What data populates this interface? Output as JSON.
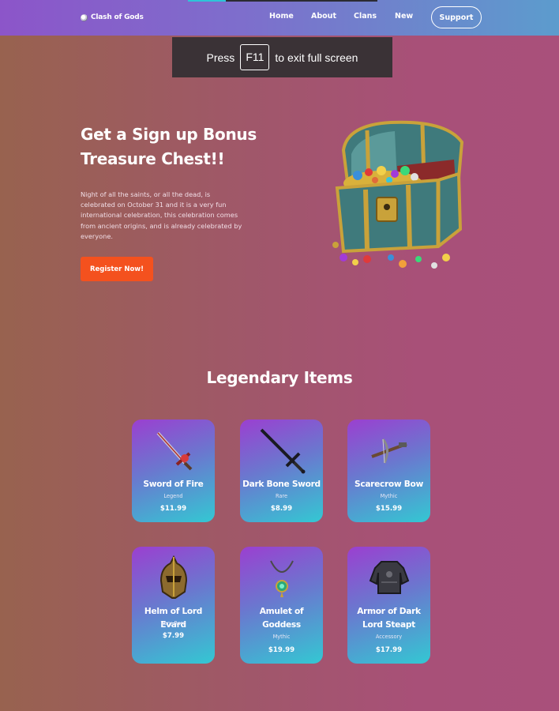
{
  "nav": {
    "brand": "Clash of Gods",
    "links": [
      "Home",
      "About",
      "Clans",
      "New"
    ],
    "support": "Support"
  },
  "fullscreen_toast": {
    "before": "Press",
    "key": "F11",
    "after": "to exit full screen"
  },
  "hero": {
    "title_line1": "Get a Sign up Bonus",
    "title_line2": "Treasure Chest!!",
    "description": "Night of all the saints, or all the dead, is celebrated on October 31 and it is a very fun international celebration, this celebration comes from ancient origins, and is already celebrated by everyone.",
    "cta": "Register Now!",
    "image_icon": "treasure-chest"
  },
  "legendary": {
    "title": "Legendary Items",
    "items": [
      {
        "name": "Sword of Fire",
        "rarity": "Legend",
        "price": "$11.99",
        "icon": "fire-sword"
      },
      {
        "name": "Dark Bone Sword",
        "rarity": "Rare",
        "price": "$8.99",
        "icon": "dark-sword"
      },
      {
        "name": "Scarecrow Bow",
        "rarity": "Mythic",
        "price": "$15.99",
        "icon": "crossbow"
      },
      {
        "name": "Helm of Lord Evard",
        "rarity": "Very Rare",
        "price": "$7.99",
        "icon": "helmet"
      },
      {
        "name": "Amulet of Goddess",
        "rarity": "Mythic",
        "price": "$19.99",
        "icon": "amulet"
      },
      {
        "name": "Armor of Dark Lord Steapt",
        "rarity": "Accessory",
        "price": "$17.99",
        "icon": "armor"
      }
    ]
  },
  "colors": {
    "accent_button": "#f4511e",
    "nav_start": "#8c55c9",
    "nav_end": "#5c9ccd",
    "card_top": "#9b3fd0",
    "card_bottom": "#33c8d3"
  }
}
